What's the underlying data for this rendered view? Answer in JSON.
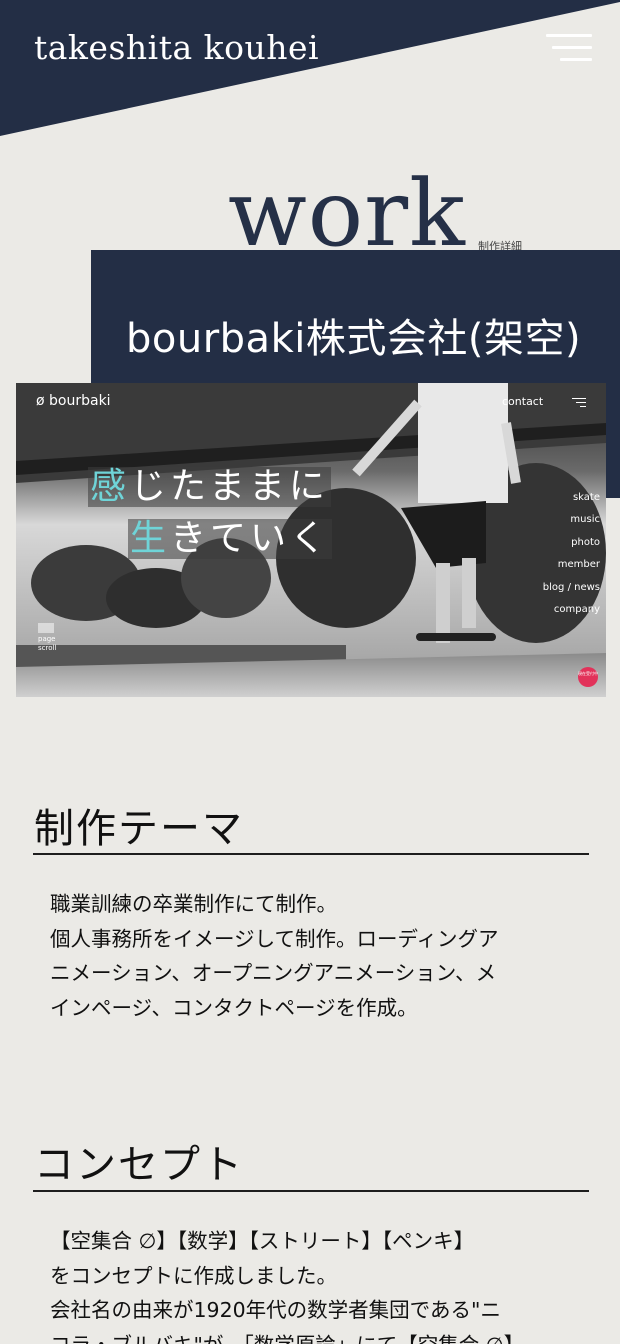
{
  "header": {
    "site_title": "takeshita kouhei",
    "menu_icon": "hamburger-menu-icon",
    "navy_color": "#232e45"
  },
  "section": {
    "heading": "work",
    "subheading": "制作詳細"
  },
  "project": {
    "title": "bourbaki株式会社(架空)"
  },
  "hero": {
    "logo": "ø bourbaki",
    "contact": "contact",
    "copy_line1_accent": "感",
    "copy_line1_rest": "じたままに",
    "copy_line2_accent": "生",
    "copy_line2_rest": "きていく",
    "accent_color": "#6fd4d8",
    "nav_items": [
      "skate",
      "music",
      "photo",
      "member",
      "blog / news",
      "company"
    ],
    "scroll_label_1": "page",
    "scroll_label_2": "scroll",
    "badge_text": "現在受付中"
  },
  "theme": {
    "heading": "制作テーマ",
    "lines": [
      "職業訓練の卒業制作にて制作。",
      "個人事務所をイメージして制作。ローディングア",
      "ニメーション、オープニングアニメーション、メ",
      "インページ、コンタクトページを作成。"
    ]
  },
  "concept": {
    "heading": "コンセプト",
    "lines": [
      "【空集合 ∅】【数学】【ストリート】【ペンキ】",
      "をコンセプトに作成しました。",
      "会社名の由来が1920年代の数学者集団である\"ニ",
      "コラ・ブルバキ\"が、「数学原論」にて【空集合 ∅】"
    ]
  }
}
